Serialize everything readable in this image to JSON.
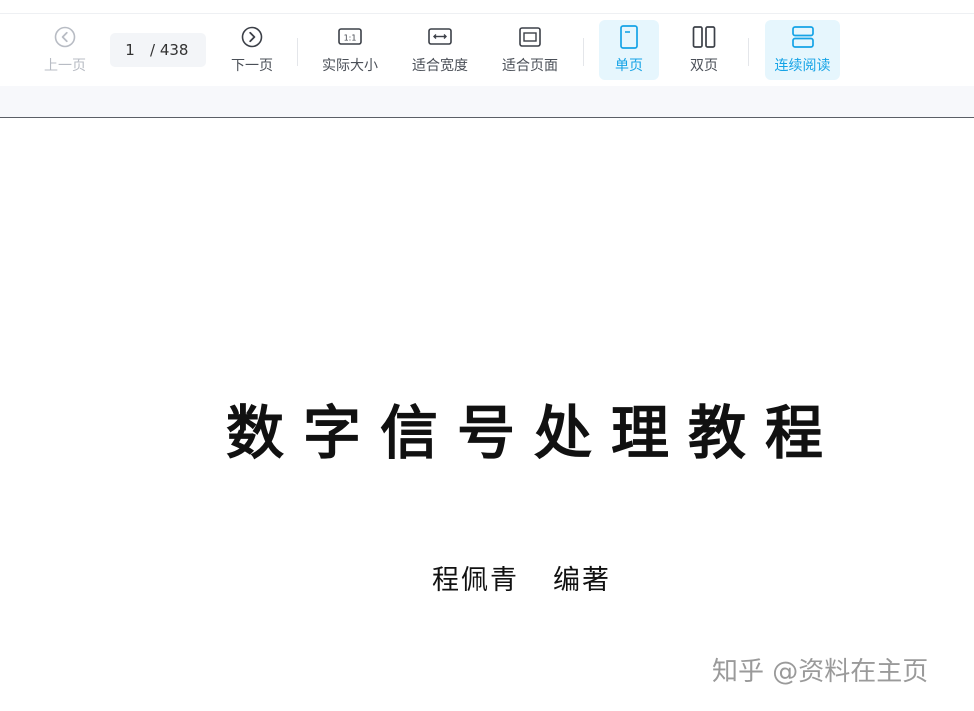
{
  "toolbar": {
    "prev_label": "上一页",
    "next_label": "下一页",
    "current_page": "1",
    "total_pages": "/ 438",
    "actual_size_label": "实际大小",
    "fit_width_label": "适合宽度",
    "fit_page_label": "适合页面",
    "single_page_label": "单页",
    "double_page_label": "双页",
    "continuous_label": "连续阅读",
    "actual_size_icon_text": "1:1"
  },
  "document": {
    "title": "数字信号处理教程",
    "author_name": "程佩青",
    "author_role": "编著"
  },
  "watermark": "知乎 @资料在主页",
  "colors": {
    "active_accent": "#15a3e6",
    "active_bg": "#e6f6fd",
    "disabled_text": "#b8bcc4"
  }
}
